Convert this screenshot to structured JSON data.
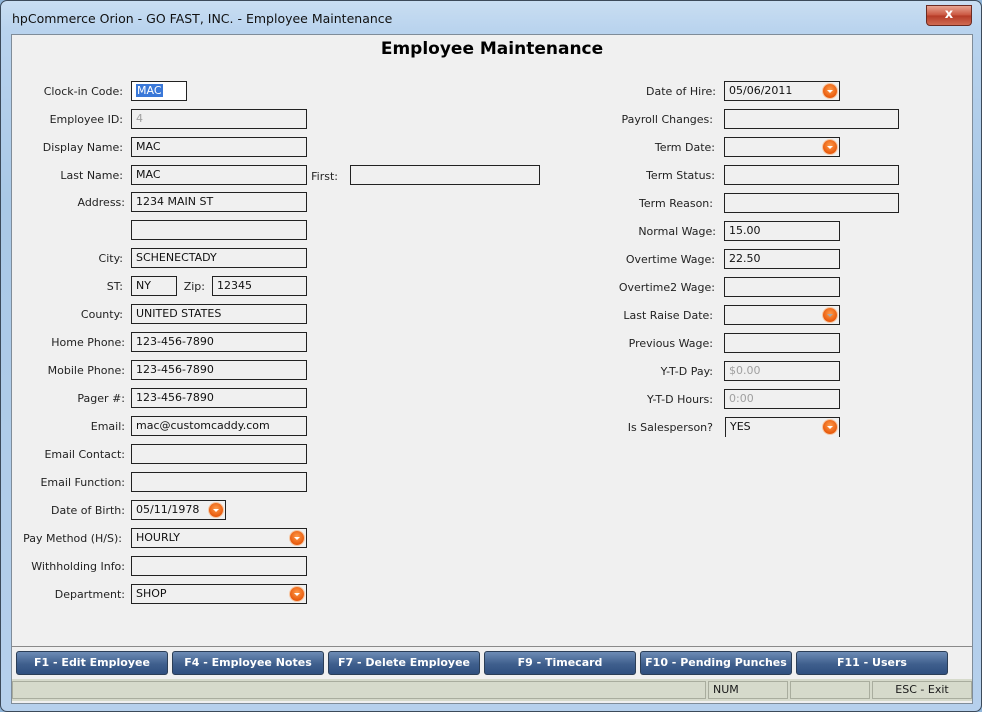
{
  "window": {
    "title": "hpCommerce Orion - GO FAST, INC. - Employee Maintenance",
    "close_label": "x"
  },
  "page_title": "Employee Maintenance",
  "left": {
    "clockin": {
      "label": "Clock-in Code:",
      "value": "MAC"
    },
    "employee_id": {
      "label": "Employee ID:",
      "value": "4"
    },
    "display_name": {
      "label": "Display Name:",
      "value": "MAC"
    },
    "last_name": {
      "label": "Last Name:",
      "value": "MAC"
    },
    "first_name": {
      "label": "First:",
      "value": ""
    },
    "address": {
      "label": "Address:",
      "value": "1234 MAIN ST",
      "value2": ""
    },
    "city": {
      "label": "City:",
      "value": "SCHENECTADY"
    },
    "st": {
      "label": "ST:",
      "value": "NY"
    },
    "zip": {
      "label": "Zip:",
      "value": "12345"
    },
    "county": {
      "label": "County:",
      "value": "UNITED STATES"
    },
    "home_phone": {
      "label": "Home Phone:",
      "value": "123-456-7890"
    },
    "mobile_phone": {
      "label": "Mobile Phone:",
      "value": "123-456-7890"
    },
    "pager": {
      "label": "Pager #:",
      "value": "123-456-7890"
    },
    "email": {
      "label": "Email:",
      "value": "mac@customcaddy.com"
    },
    "email_contact": {
      "label": "Email Contact:",
      "value": ""
    },
    "email_function": {
      "label": "Email Function:",
      "value": ""
    },
    "dob": {
      "label": "Date of Birth:",
      "value": "05/11/1978"
    },
    "pay_method": {
      "label": "Pay Method (H/S):",
      "value": "HOURLY"
    },
    "withholding": {
      "label": "Withholding Info:",
      "value": ""
    },
    "department": {
      "label": "Department:",
      "value": "SHOP"
    }
  },
  "right": {
    "hire_date": {
      "label": "Date of Hire:",
      "value": "05/06/2011"
    },
    "payroll_changes": {
      "label": "Payroll Changes:",
      "value": ""
    },
    "term_date": {
      "label": "Term Date:",
      "value": ""
    },
    "term_status": {
      "label": "Term Status:",
      "value": ""
    },
    "term_reason": {
      "label": "Term Reason:",
      "value": ""
    },
    "normal_wage": {
      "label": "Normal Wage:",
      "value": "15.00"
    },
    "overtime_wage": {
      "label": "Overtime Wage:",
      "value": "22.50"
    },
    "overtime2_wage": {
      "label": "Overtime2 Wage:",
      "value": ""
    },
    "last_raise": {
      "label": "Last Raise Date:",
      "value": ""
    },
    "previous_wage": {
      "label": "Previous Wage:",
      "value": ""
    },
    "ytd_pay": {
      "label": "Y-T-D Pay:",
      "value": "$0.00"
    },
    "ytd_hours": {
      "label": "Y-T-D Hours:",
      "value": "0:00"
    },
    "salesperson": {
      "label": "Is Salesperson?",
      "value": "YES"
    }
  },
  "buttons": [
    "F1 - Edit Employee",
    "F4 - Employee Notes",
    "F7 - Delete Employee",
    "F9 - Timecard",
    "F10 - Pending Punches",
    "F11 - Users"
  ],
  "status": {
    "pane1": "",
    "num": "NUM",
    "pane3": "",
    "exit": "ESC - Exit"
  }
}
